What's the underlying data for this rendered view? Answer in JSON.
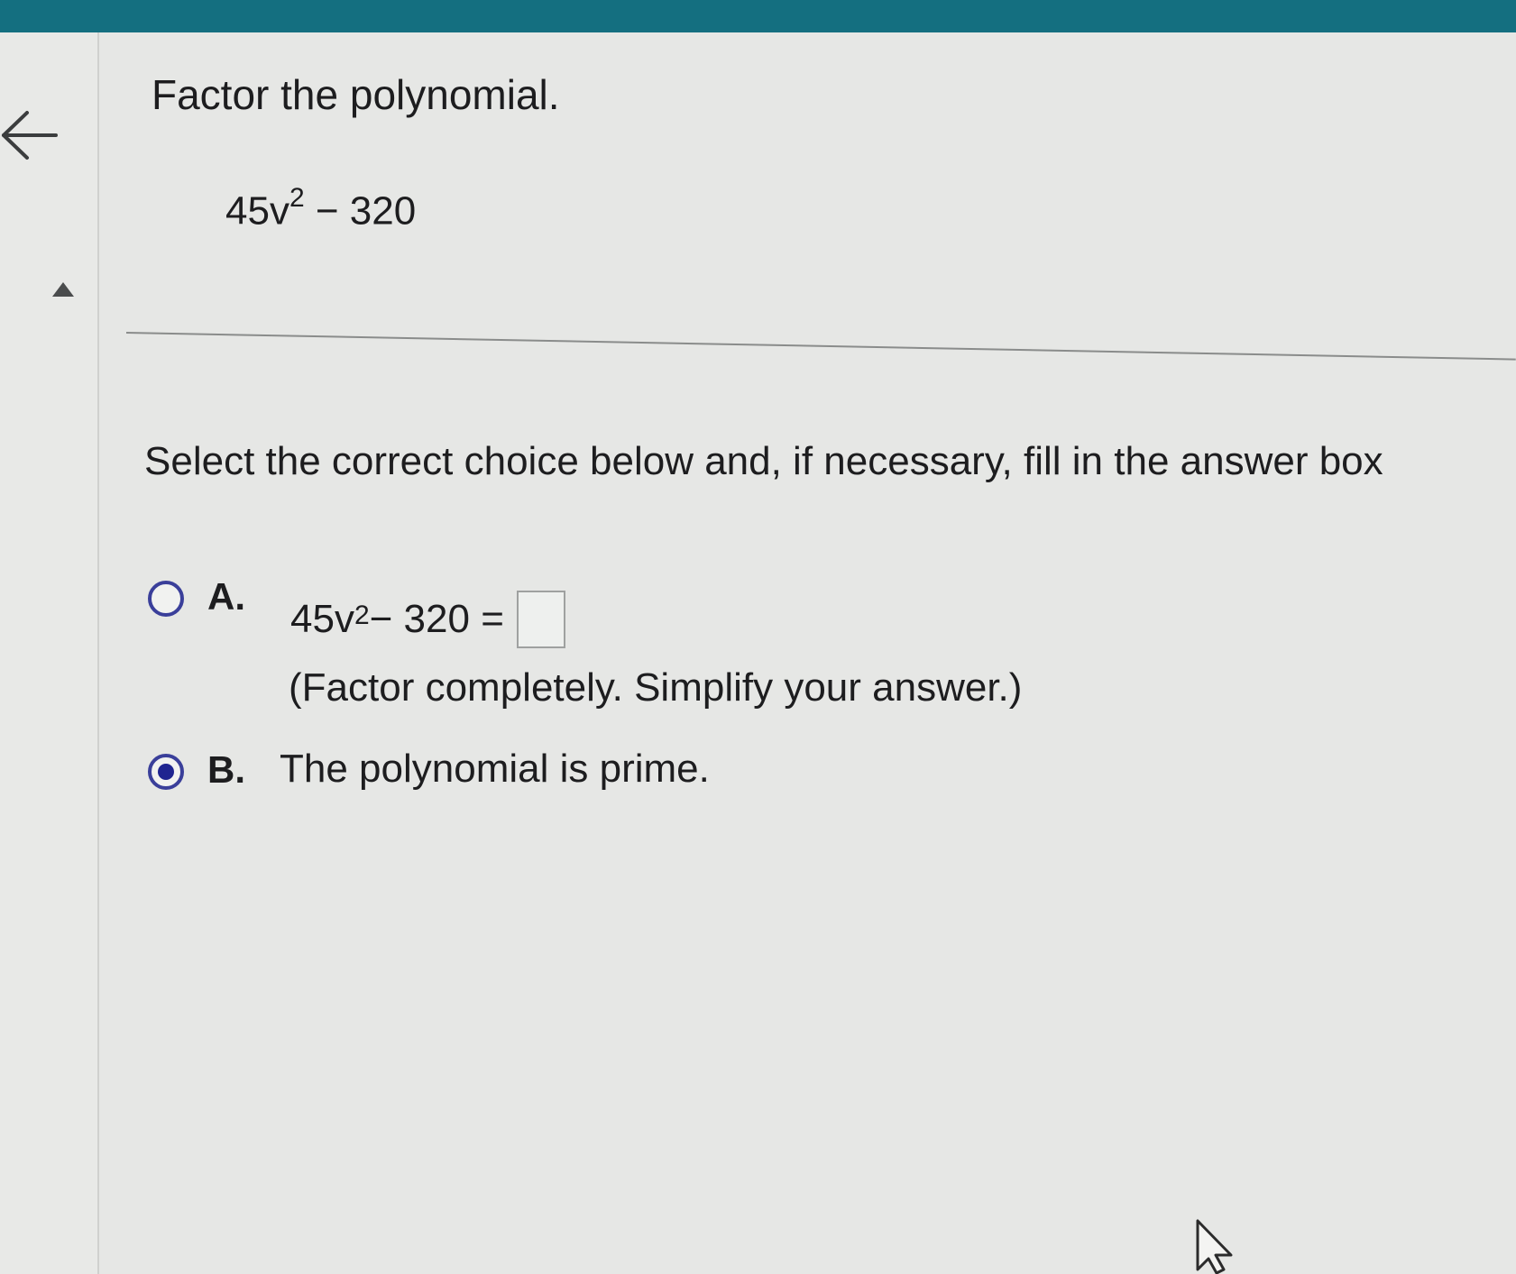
{
  "question": {
    "title": "Factor the polynomial.",
    "expression": {
      "coefficient": "45v",
      "exponent": "2",
      "rest": " − 320"
    }
  },
  "instruction": "Select the correct choice below and, if necessary, fill in the answer box",
  "choices": [
    {
      "letter": "A.",
      "expression": {
        "coefficient": "45v",
        "exponent": "2",
        "rest": " − 320 ="
      },
      "answer_value": "",
      "hint": "(Factor completely. Simplify your answer.)",
      "selected": false
    },
    {
      "letter": "B.",
      "text": "The polynomial is prime.",
      "selected": true
    }
  ],
  "colors": {
    "header": "#146f80",
    "radio_border": "#3a3f9a",
    "radio_fill": "#1f2590",
    "background": "#e6e7e5"
  },
  "icons": {
    "back": "arrow-left-icon",
    "collapse": "triangle-up-icon",
    "cursor": "mouse-pointer-icon"
  }
}
